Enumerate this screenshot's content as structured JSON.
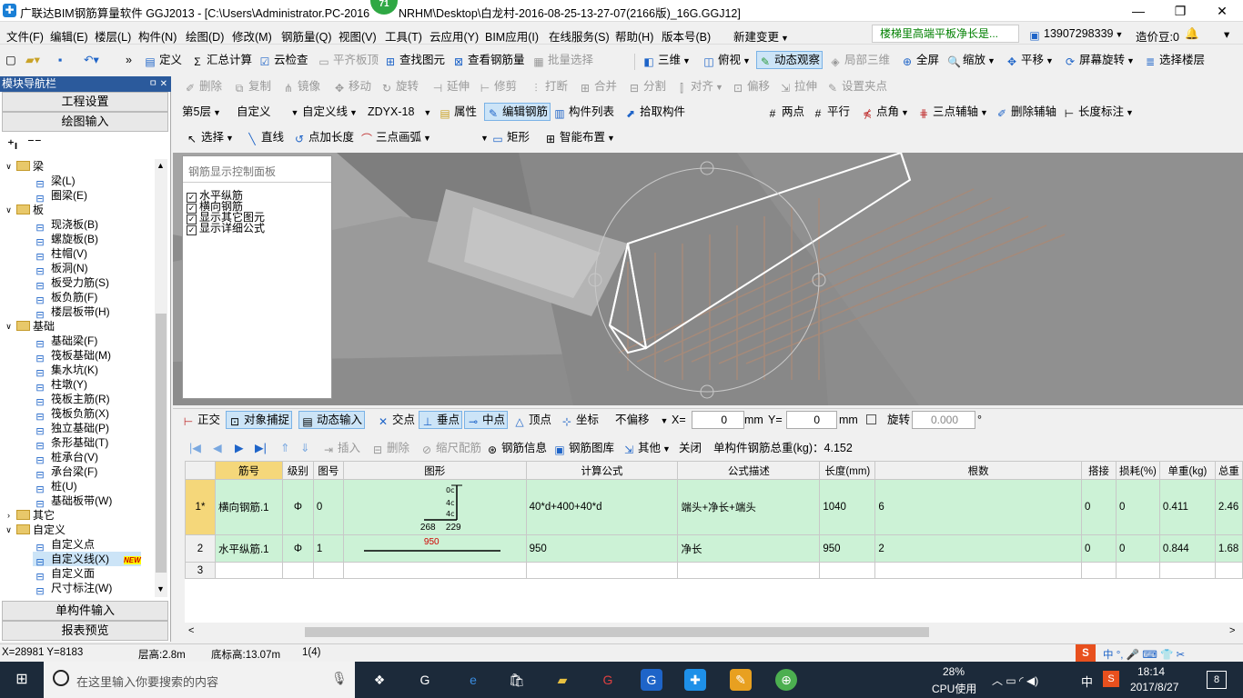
{
  "window": {
    "title": "广联达BIM钢筋算量软件 GGJ2013 - [C:\\Users\\Administrator.PC-2016",
    "title_tail": "NRHM\\Desktop\\白龙村-2016-08-25-13-27-07(2166版)_16G.GGJ12]",
    "badge": "71",
    "min": "—",
    "max": "❐",
    "close": "✕"
  },
  "menu": {
    "items": [
      "文件(F)",
      "编辑(E)",
      "楼层(L)",
      "构件(N)",
      "绘图(D)",
      "修改(M)",
      "钢筋量(Q)",
      "视图(V)",
      "工具(T)",
      "云应用(Y)",
      "BIM应用(I)",
      "在线服务(S)",
      "帮助(H)",
      "版本号(B)",
      "新建变更"
    ],
    "notice": "楼梯里高端平板净长是...",
    "phone": "13907298339",
    "credits": "造价豆:0"
  },
  "toolbar1": {
    "items": [
      "定义",
      "汇总计算",
      "云检查",
      "平齐板顶",
      "查找图元",
      "查看钢筋量",
      "批量选择",
      "三维",
      "俯视",
      "动态观察",
      "局部三维",
      "全屏",
      "缩放",
      "平移",
      "屏幕旋转",
      "选择楼层"
    ]
  },
  "toolbar2": {
    "items": [
      "删除",
      "复制",
      "镜像",
      "移动",
      "旋转",
      "延伸",
      "修剪",
      "打断",
      "合并",
      "分割",
      "对齐",
      "偏移",
      "拉伸",
      "设置夹点"
    ]
  },
  "toolbar3": {
    "floor": "第5层",
    "category": "自定义",
    "type": "自定义线",
    "code": "ZDYX-18",
    "items": [
      "属性",
      "编辑钢筋",
      "构件列表",
      "拾取构件"
    ],
    "right": [
      "两点",
      "平行",
      "点角",
      "三点辅轴",
      "删除辅轴",
      "长度标注"
    ]
  },
  "toolbar4": {
    "items": [
      "选择",
      "直线",
      "点加长度",
      "三点画弧",
      "矩形",
      "智能布置"
    ]
  },
  "leftpanel": {
    "title": "模块导航栏",
    "pin": "ㅁ ✕",
    "tabs": [
      "工程设置",
      "绘图输入"
    ],
    "bottom_tabs": [
      "单构件输入",
      "报表预览"
    ],
    "tree": [
      {
        "label": "梁",
        "level": 0,
        "expanded": true
      },
      {
        "label": "梁(L)",
        "level": 1
      },
      {
        "label": "圈梁(E)",
        "level": 1
      },
      {
        "label": "板",
        "level": 0,
        "expanded": true
      },
      {
        "label": "现浇板(B)",
        "level": 1
      },
      {
        "label": "螺旋板(B)",
        "level": 1
      },
      {
        "label": "柱帽(V)",
        "level": 1
      },
      {
        "label": "板洞(N)",
        "level": 1
      },
      {
        "label": "板受力筋(S)",
        "level": 1
      },
      {
        "label": "板负筋(F)",
        "level": 1
      },
      {
        "label": "楼层板带(H)",
        "level": 1
      },
      {
        "label": "基础",
        "level": 0,
        "expanded": true
      },
      {
        "label": "基础梁(F)",
        "level": 1
      },
      {
        "label": "筏板基础(M)",
        "level": 1
      },
      {
        "label": "集水坑(K)",
        "level": 1
      },
      {
        "label": "柱墩(Y)",
        "level": 1
      },
      {
        "label": "筏板主筋(R)",
        "level": 1
      },
      {
        "label": "筏板负筋(X)",
        "level": 1
      },
      {
        "label": "独立基础(P)",
        "level": 1
      },
      {
        "label": "条形基础(T)",
        "level": 1
      },
      {
        "label": "桩承台(V)",
        "level": 1
      },
      {
        "label": "承台梁(F)",
        "level": 1
      },
      {
        "label": "桩(U)",
        "level": 1
      },
      {
        "label": "基础板带(W)",
        "level": 1
      },
      {
        "label": "其它",
        "level": 0,
        "expanded": false
      },
      {
        "label": "自定义",
        "level": 0,
        "expanded": true
      },
      {
        "label": "自定义点",
        "level": 1
      },
      {
        "label": "自定义线(X)",
        "level": 1,
        "new": "NEW"
      },
      {
        "label": "自定义面",
        "level": 1
      },
      {
        "label": "尺寸标注(W)",
        "level": 1
      }
    ]
  },
  "control_panel": {
    "title": "钢筋显示控制面板",
    "options": [
      "水平纵筋",
      "横向钢筋",
      "显示其它图元",
      "显示详细公式"
    ]
  },
  "snapbar": {
    "items": [
      "正交",
      "对象捕捉",
      "动态输入",
      "交点",
      "垂点",
      "中点",
      "顶点",
      "坐标"
    ],
    "offset": "不偏移",
    "x_label": "X=",
    "x_value": "0",
    "y_label": "Y=",
    "y_value": "0",
    "unit": "mm",
    "rotate_label": "旋转",
    "rotate_value": "0.000",
    "deg": "°"
  },
  "rebar_toolbar": {
    "items": [
      "插入",
      "删除",
      "缩尺配筋",
      "钢筋信息",
      "钢筋图库",
      "其他",
      "关闭"
    ],
    "total_weight": "单构件钢筋总重(kg)：4.152"
  },
  "table": {
    "headers": [
      "",
      "筋号",
      "级别",
      "图号",
      "图形",
      "计算公式",
      "公式描述",
      "长度(mm)",
      "根数",
      "搭接",
      "损耗(%)",
      "单重(kg)",
      "总重"
    ],
    "rows": [
      {
        "idx": "1*",
        "name": "横向钢筋.1",
        "grade": "Φ",
        "fig": "0",
        "formula": "40*d+400+40*d",
        "desc": "端头+净长+端头",
        "length": "1040",
        "count": "6",
        "lap": "0",
        "loss": "0",
        "unit_w": "0.411",
        "total_w": "2.46",
        "shape_labels": [
          "268",
          "229"
        ]
      },
      {
        "idx": "2",
        "name": "水平纵筋.1",
        "grade": "Φ",
        "fig": "1",
        "formula": "950",
        "desc": "净长",
        "length": "950",
        "count": "2",
        "lap": "0",
        "loss": "0",
        "unit_w": "0.844",
        "total_w": "1.68",
        "shape_labels": [
          "950"
        ]
      },
      {
        "idx": "3",
        "name": "",
        "grade": "",
        "fig": "",
        "formula": "",
        "desc": "",
        "length": "",
        "count": "",
        "lap": "",
        "loss": "",
        "unit_w": "",
        "total_w": ""
      }
    ]
  },
  "statusbar": {
    "coords": "X=28981 Y=8183",
    "floor_height": "层高:2.8m",
    "base_height": "底标高:13.07m",
    "sel": "1(4)"
  },
  "taskbar": {
    "search_placeholder": "在这里输入你要搜索的内容",
    "cpu_pct": "28%",
    "cpu_label": "CPU使用",
    "ime": "中",
    "time": "18:14",
    "date": "2017/8/27",
    "notif": "8"
  }
}
